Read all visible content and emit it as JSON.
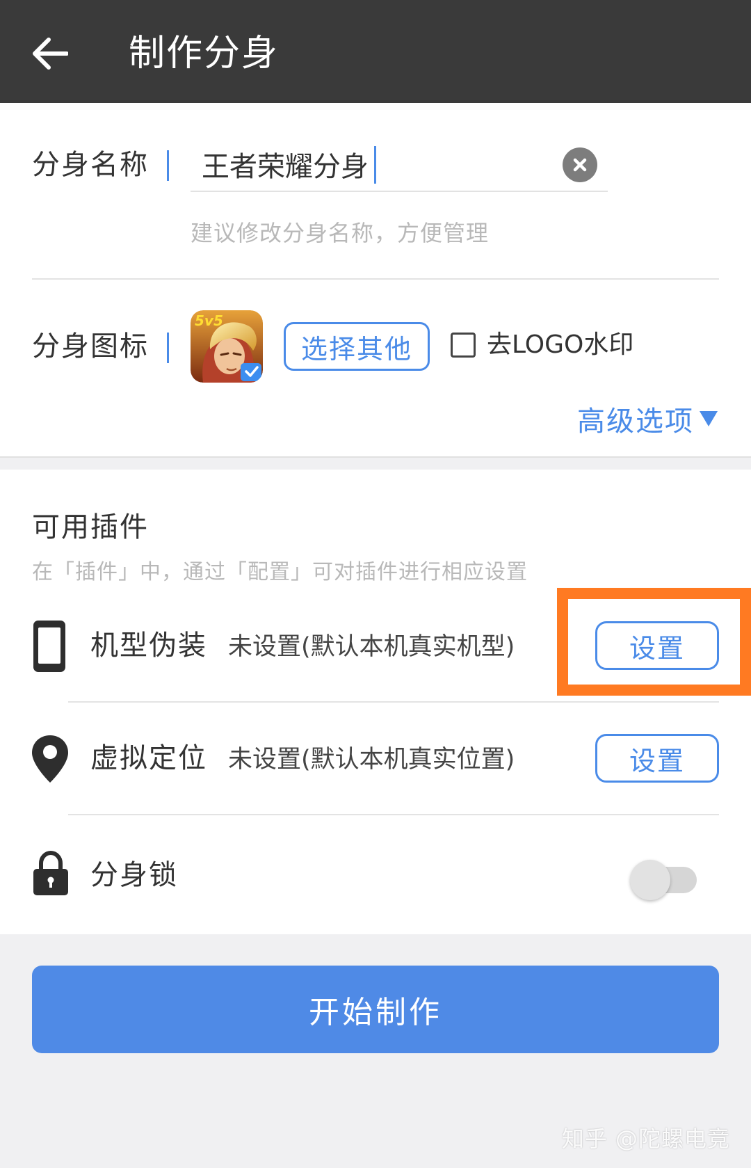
{
  "header": {
    "title": "制作分身"
  },
  "clone_name": {
    "label": "分身名称",
    "value": "王者荣耀分身",
    "hint": "建议修改分身名称，方便管理"
  },
  "clone_icon": {
    "label": "分身图标",
    "choose_label": "选择其他",
    "remove_logo_label": "去LOGO水印",
    "remove_logo_checked": false,
    "advanced_label": "高级选项",
    "icon_badge_text": "5v5"
  },
  "plugins": {
    "title": "可用插件",
    "subtitle": "在「插件」中，通过「配置」可对插件进行相应设置",
    "items": [
      {
        "name": "机型伪装",
        "desc": "未设置(默认本机真实机型)",
        "button": "设置",
        "icon": "phone-icon"
      },
      {
        "name": "虚拟定位",
        "desc": "未设置(默认本机真实位置)",
        "button": "设置",
        "icon": "location-pin-icon"
      },
      {
        "name": "分身锁",
        "icon": "lock-icon",
        "enabled": false
      }
    ]
  },
  "actions": {
    "start_label": "开始制作"
  },
  "watermark": "知乎 @陀螺电竞",
  "colors": {
    "accent": "#4a8be8",
    "highlight": "#ff7a22",
    "topbar": "#3a3a3a"
  }
}
